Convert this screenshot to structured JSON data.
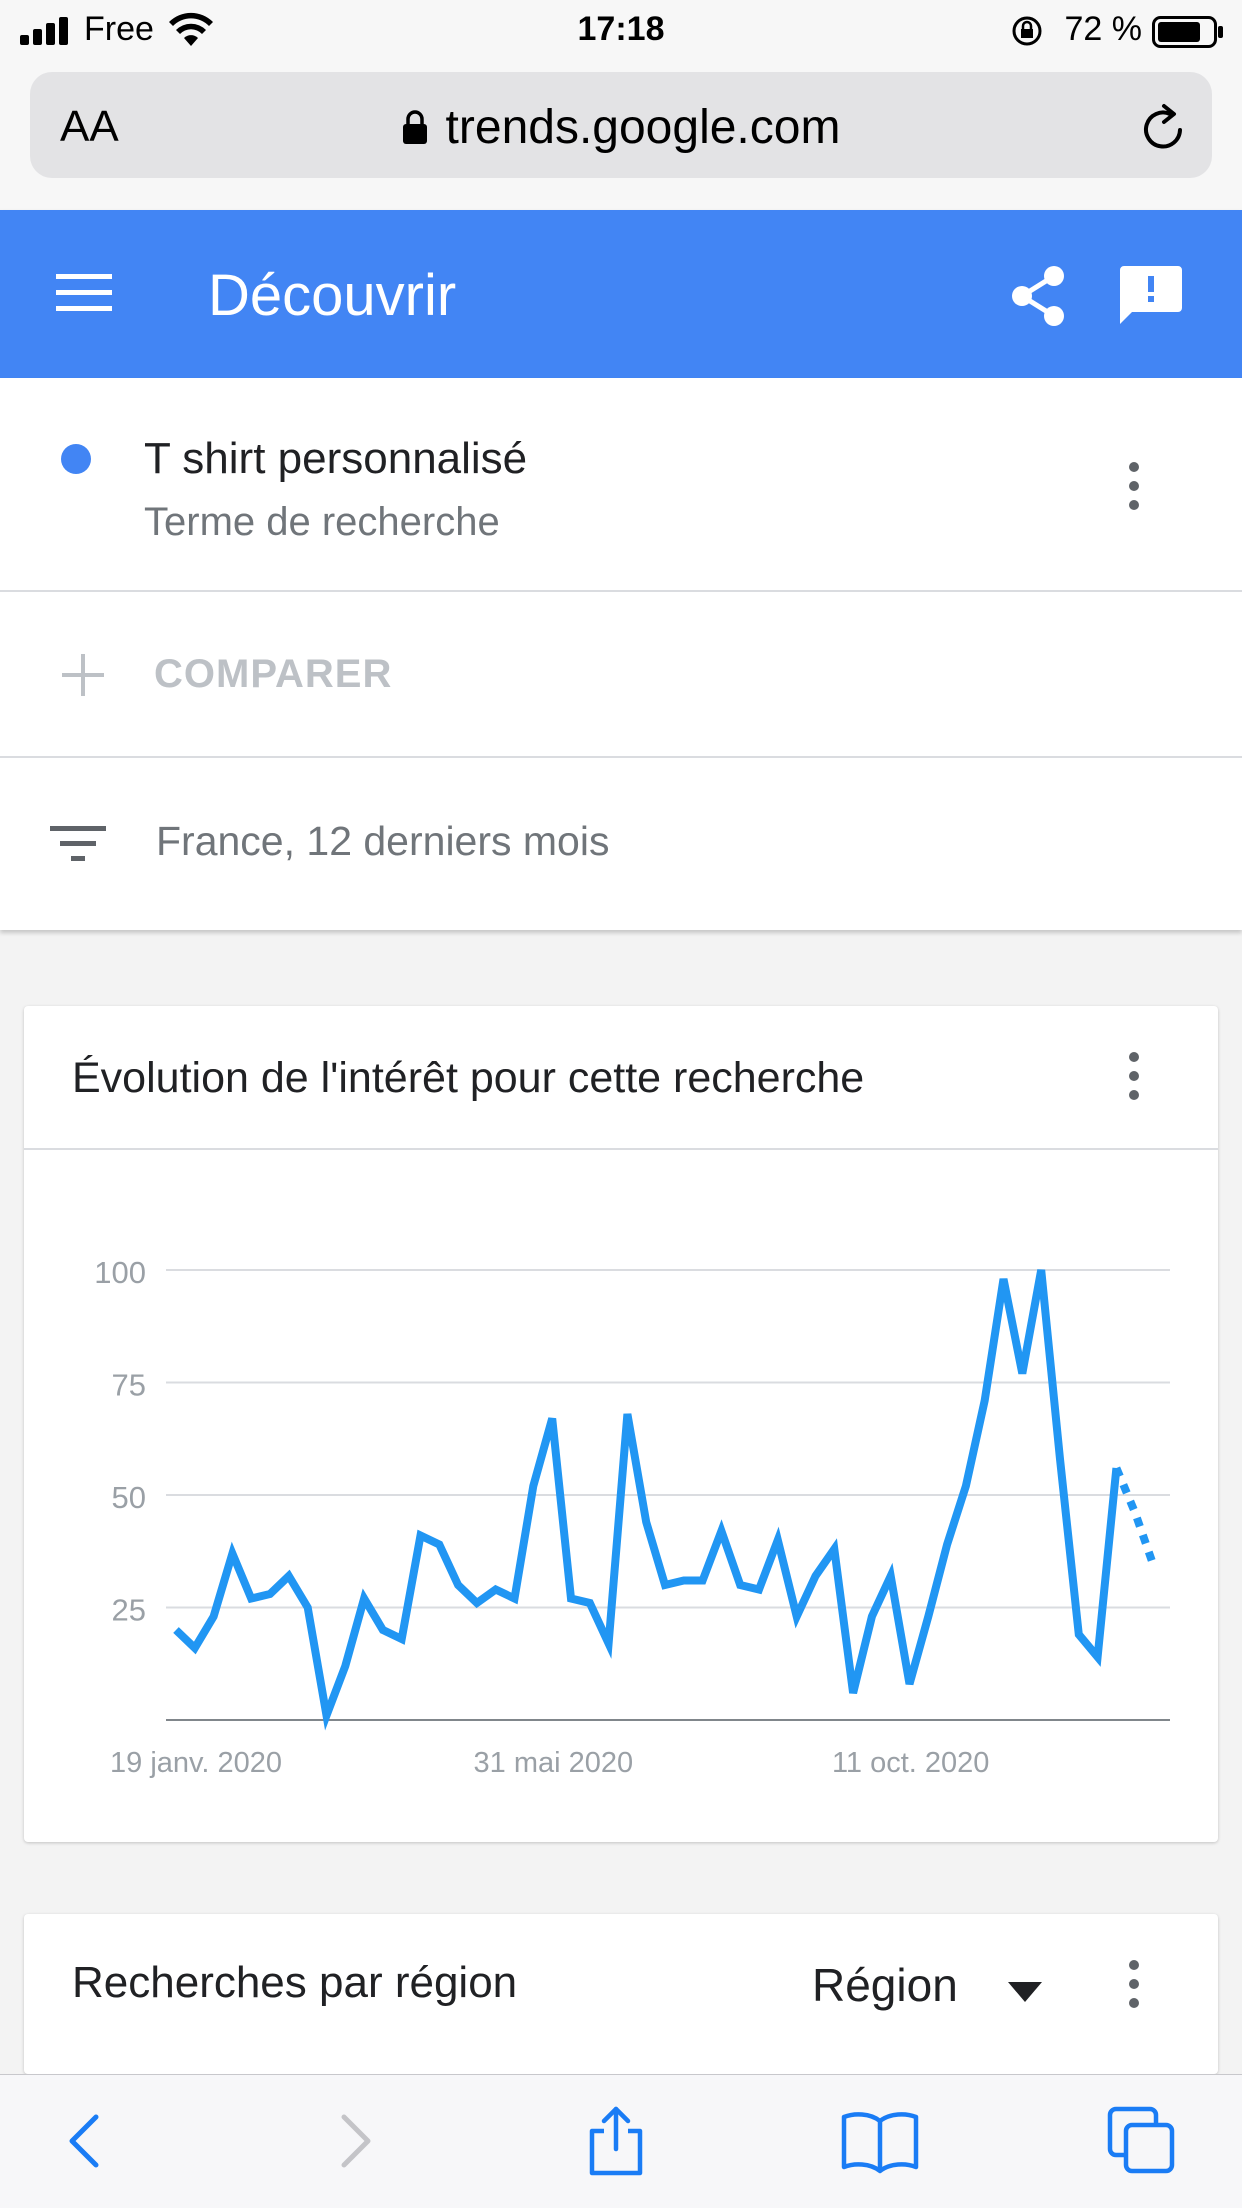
{
  "status_bar": {
    "carrier": "Free",
    "time": "17:18",
    "battery": "72 %"
  },
  "browser": {
    "text_size_label": "AA",
    "url": "trends.google.com"
  },
  "app_bar": {
    "title": "Découvrir"
  },
  "search_term": {
    "name": "T shirt personnalisé",
    "type": "Terme de recherche",
    "color": "#4285f4"
  },
  "compare": {
    "label": "COMPARER"
  },
  "filter": {
    "label": "France, 12 derniers mois"
  },
  "interest_card": {
    "title": "Évolution de l'intérêt pour cette recherche"
  },
  "chart_data": {
    "type": "line",
    "title": "",
    "xlabel": "",
    "ylabel": "",
    "ylim": [
      0,
      100
    ],
    "yticks": [
      100,
      75,
      50,
      25
    ],
    "xtick_labels": [
      "19 janv. 2020",
      "31 mai 2020",
      "11 oct. 2020"
    ],
    "xtick_indices": [
      0,
      19,
      38
    ],
    "grid": true,
    "color": "#2196f3",
    "series": [
      {
        "values": [
          20,
          16,
          23,
          37,
          27,
          28,
          32,
          25,
          1,
          12,
          27,
          20,
          18,
          41,
          39,
          30,
          26,
          29,
          27,
          52,
          67,
          27,
          26,
          17,
          68,
          44,
          30,
          31,
          31,
          42,
          30,
          29,
          40,
          23,
          32,
          38,
          6,
          23,
          32,
          8,
          23,
          39,
          52,
          71,
          98,
          77,
          100,
          58,
          19,
          14,
          56
        ],
        "partial_tail": [
          56,
          46,
          34
        ]
      }
    ]
  },
  "region_card": {
    "title": "Recherches par région",
    "selector_value": "Région"
  },
  "colors": {
    "app_bar": "#4285f4",
    "line": "#2196f3",
    "ios_blue": "#1a7cf5"
  }
}
